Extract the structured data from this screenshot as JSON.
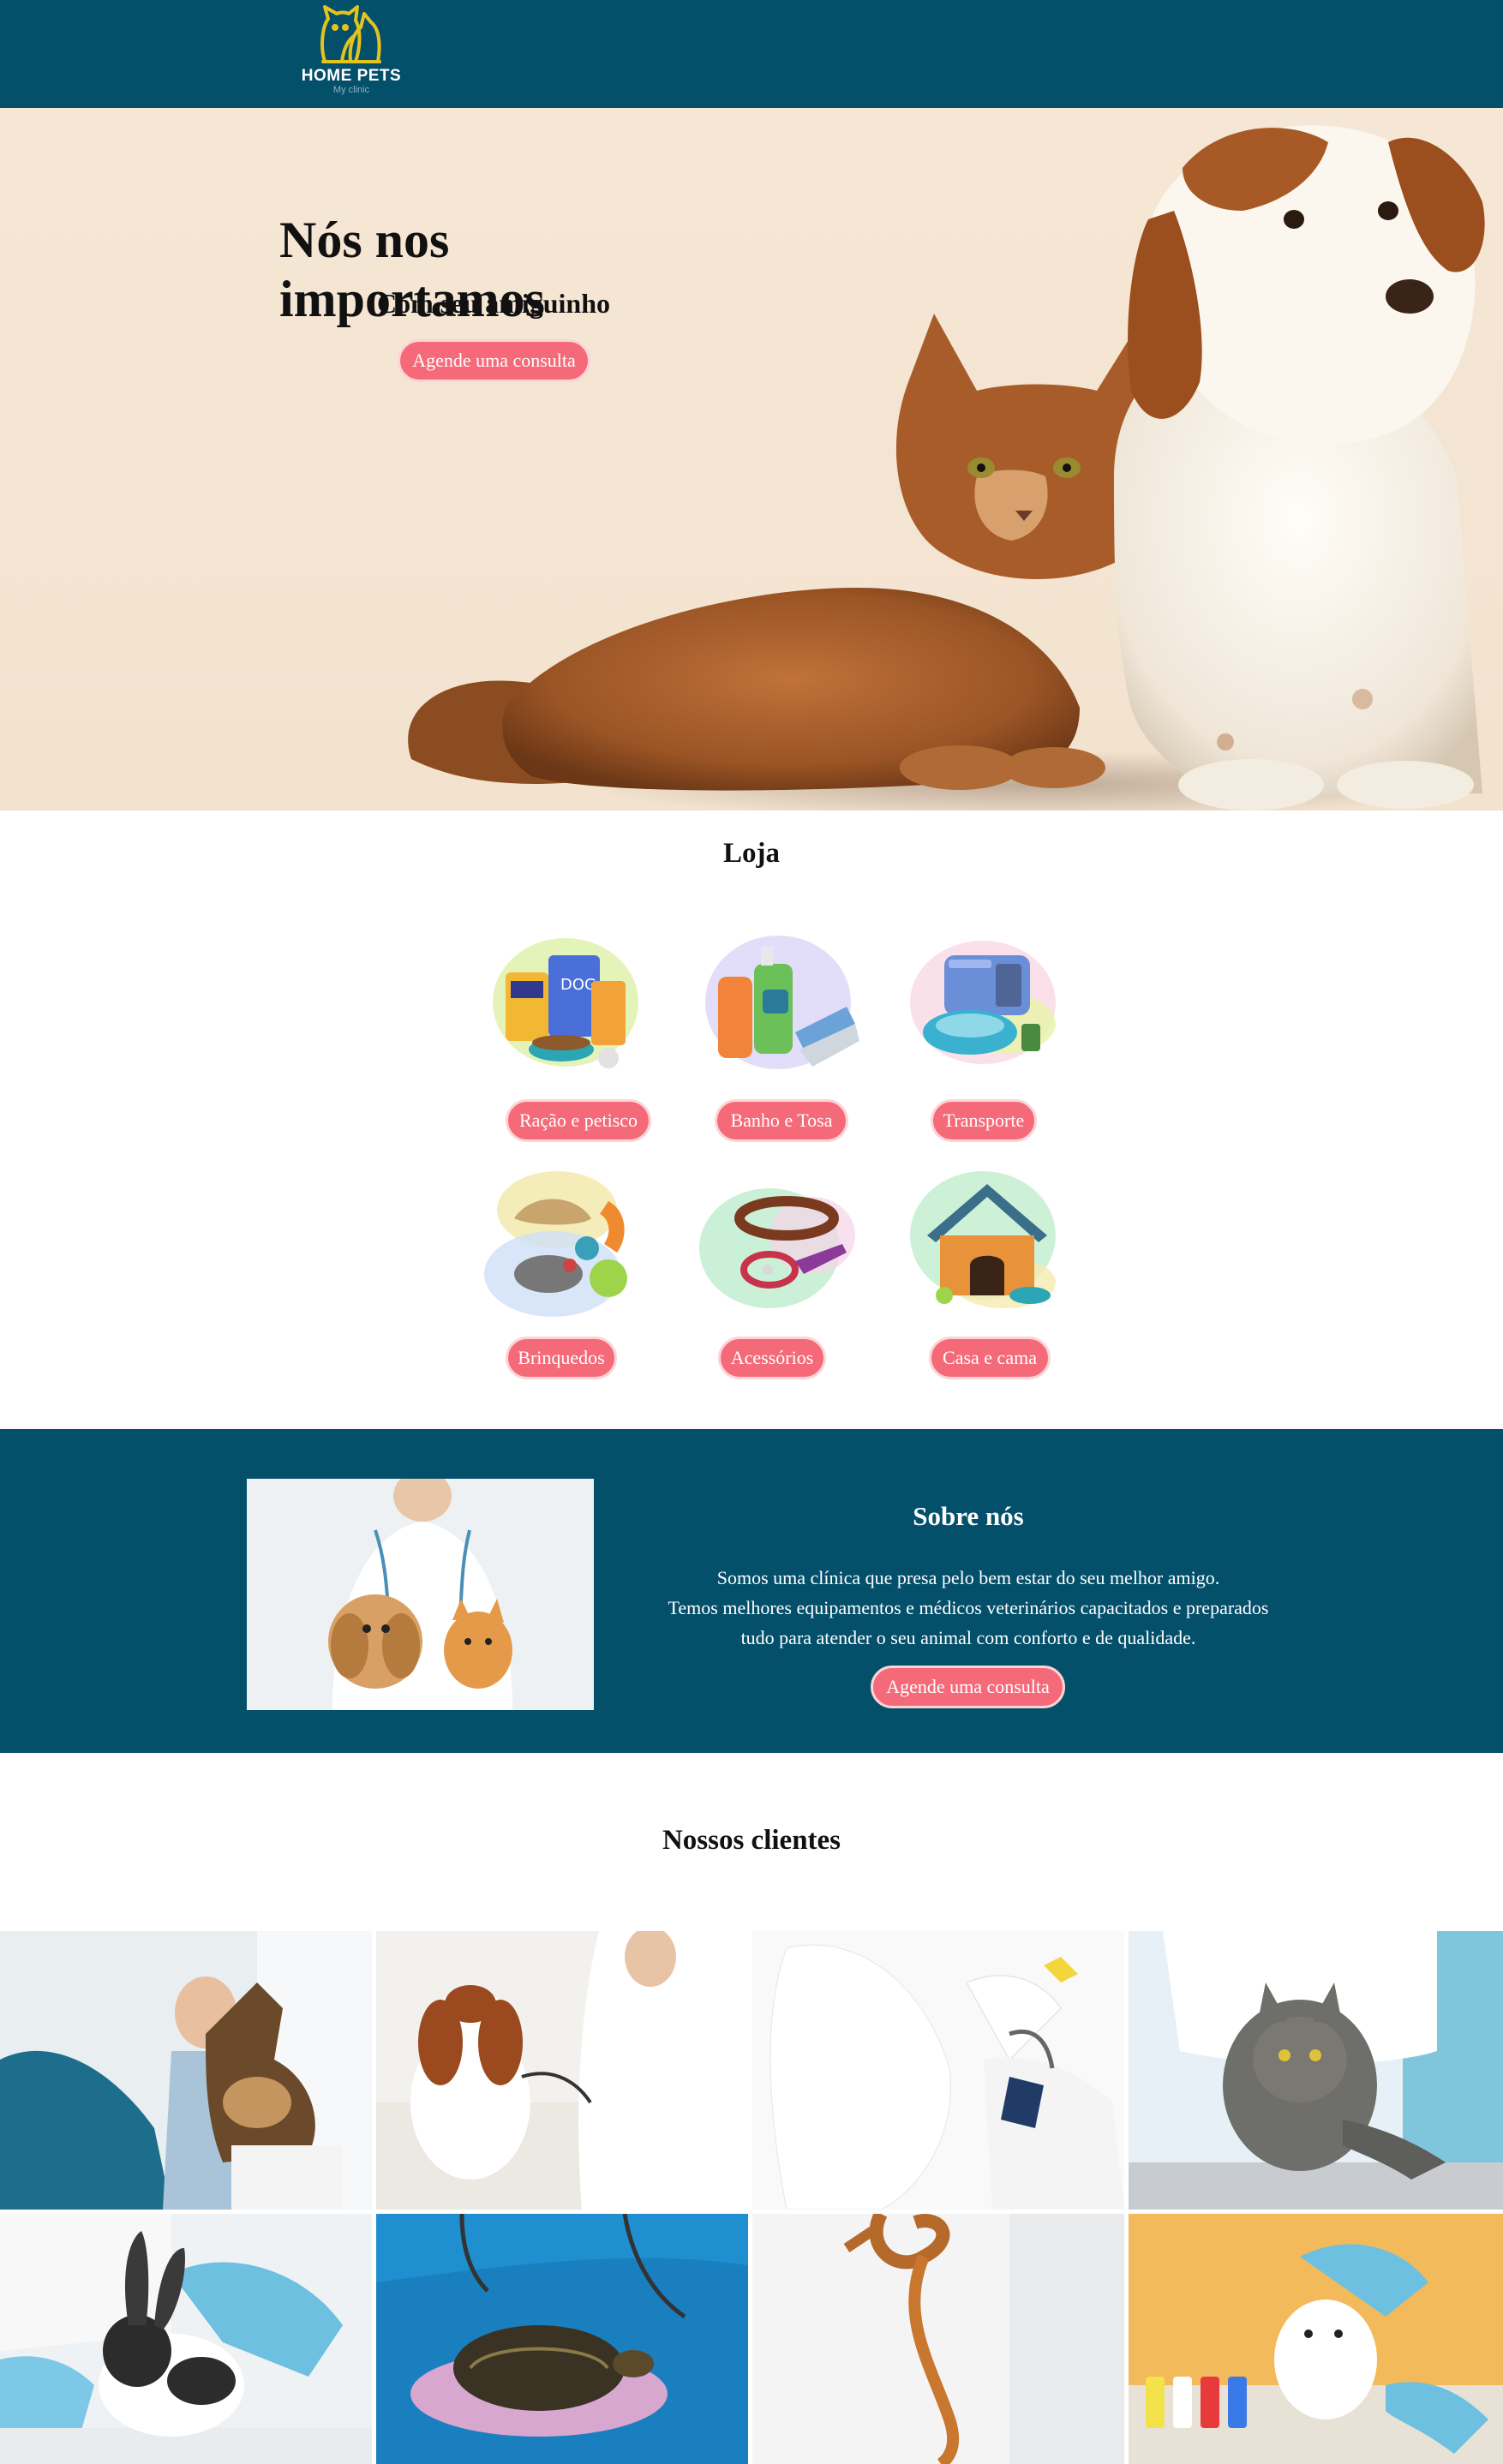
{
  "header": {
    "logo_name": "HOME PETS",
    "logo_sub": "My clinic",
    "background": "#04506b",
    "logo_color": "#e3c31f"
  },
  "hero": {
    "title": "Nós nos importamos",
    "subtitle": "Com seu amiguinho",
    "cta_label": "Agende uma consulta"
  },
  "shop": {
    "title": "Loja",
    "items": [
      {
        "label": "Ração e petisco",
        "icon": "pet-food-icon"
      },
      {
        "label": "Banho e Tosa",
        "icon": "shampoo-brush-icon"
      },
      {
        "label": "Transporte",
        "icon": "pet-carrier-icon"
      },
      {
        "label": "Brinquedos",
        "icon": "pet-toys-icon"
      },
      {
        "label": "Acessórios",
        "icon": "collar-leash-icon"
      },
      {
        "label": "Casa e cama",
        "icon": "dog-house-icon"
      }
    ]
  },
  "about": {
    "title": "Sobre nós",
    "line1": "Somos uma clínica que presa pelo bem estar do seu melhor amigo.",
    "line2": "Temos melhores equipamentos e médicos veterinários capacitados e preparados",
    "line3": "tudo para atender o seu animal com conforto e de qualidade.",
    "cta_label": "Agende uma consulta"
  },
  "clients": {
    "title": "Nossos clientes",
    "photos": [
      "dog-at-vet-photo",
      "spaniel-exam-photo",
      "cockatoo-photo",
      "cat-on-table-photo",
      "rabbit-photo",
      "turtle-photo",
      "snake-photo",
      "hamster-photo"
    ]
  },
  "colors": {
    "accent": "#f56a79",
    "brand": "#04506b"
  }
}
